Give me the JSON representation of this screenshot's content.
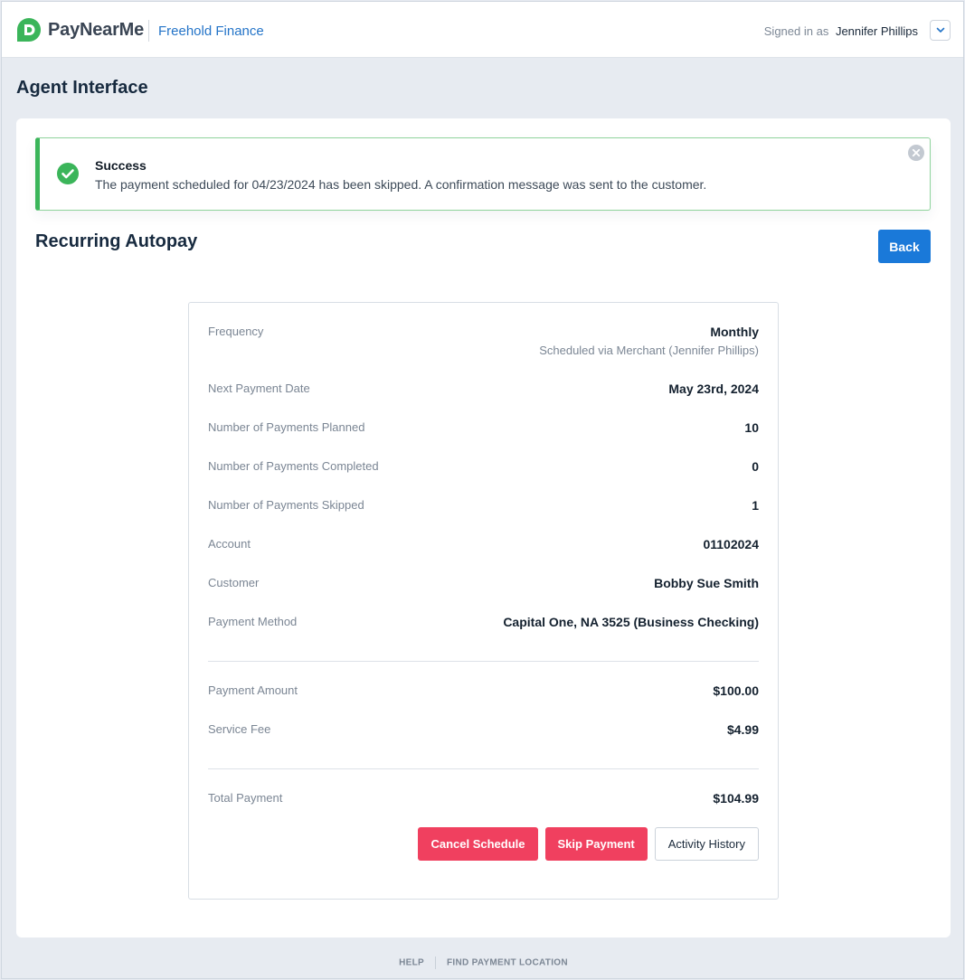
{
  "header": {
    "brand": "PayNearMe",
    "merchant": "Freehold Finance",
    "signed_in_label": "Signed in as",
    "user_name": "Jennifer Phillips",
    "brand_color": "#3bb55a"
  },
  "page": {
    "title": "Agent Interface"
  },
  "alert": {
    "title": "Success",
    "message": "The payment scheduled for 04/23/2024 has been skipped. A confirmation message was sent to the customer.",
    "icon": "check-circle-icon",
    "color": "#3bb55a"
  },
  "section": {
    "title": "Recurring Autopay",
    "back_label": "Back"
  },
  "details": {
    "frequency": {
      "label": "Frequency",
      "value": "Monthly",
      "sub": "Scheduled via Merchant (Jennifer Phillips)"
    },
    "next_payment": {
      "label": "Next Payment Date",
      "value": "May 23rd, 2024"
    },
    "planned": {
      "label": "Number of Payments Planned",
      "value": "10"
    },
    "completed": {
      "label": "Number of Payments Completed",
      "value": "0"
    },
    "skipped": {
      "label": "Number of Payments Skipped",
      "value": "1"
    },
    "account": {
      "label": "Account",
      "value": "01102024"
    },
    "customer": {
      "label": "Customer",
      "value": "Bobby Sue Smith"
    },
    "payment_method": {
      "label": "Payment Method",
      "value": "Capital One, NA 3525 (Business Checking)"
    },
    "payment_amount": {
      "label": "Payment Amount",
      "value": "$100.00"
    },
    "service_fee": {
      "label": "Service Fee",
      "value": "$4.99"
    },
    "total_payment": {
      "label": "Total Payment",
      "value": "$104.99"
    }
  },
  "actions": {
    "cancel_label": "Cancel Schedule",
    "skip_label": "Skip Payment",
    "history_label": "Activity History",
    "danger_color": "#f0405f",
    "primary_color": "#1a79d9"
  },
  "footer": {
    "help": "HELP",
    "find_location": "FIND PAYMENT LOCATION"
  }
}
